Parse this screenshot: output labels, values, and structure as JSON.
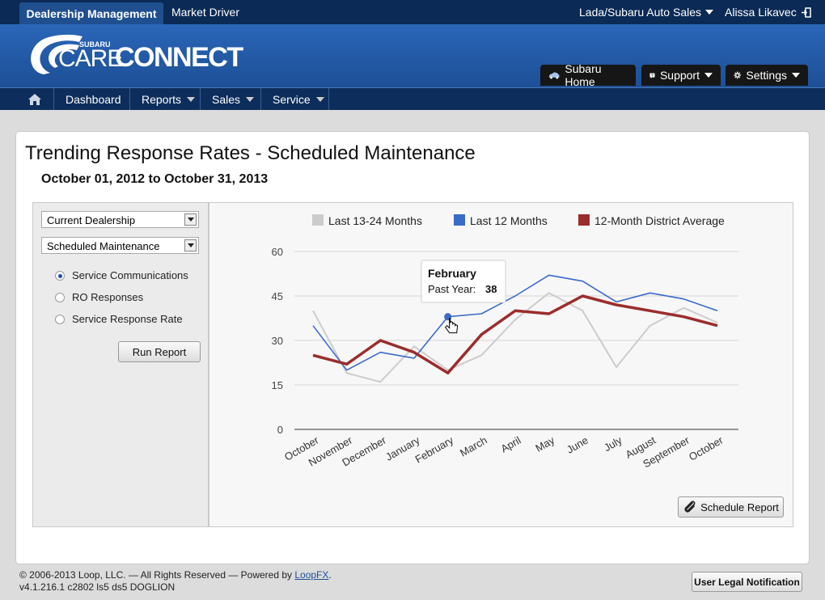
{
  "topbar": {
    "active_tab": "Dealership Management",
    "tab2": "Market Driver",
    "dealer": "Lada/Subaru Auto Sales",
    "user": "Alissa Likavec"
  },
  "header": {
    "logo_brand": "SUBARU",
    "logo_care": "CARE",
    "logo_connect": "CONNECT",
    "btn_home": "Subaru Home",
    "btn_support": "Support",
    "btn_settings": "Settings"
  },
  "nav": {
    "dashboard": "Dashboard",
    "reports": "Reports",
    "sales": "Sales",
    "service": "Service"
  },
  "report": {
    "title": "Trending Response Rates - Scheduled Maintenance",
    "date_range": "October 01, 2012 to October 31, 2013"
  },
  "filters": {
    "select1": "Current Dealership",
    "select2": "Scheduled Maintenance",
    "radio1": "Service Communications",
    "radio2": "RO Responses",
    "radio3": "Service Response Rate",
    "run_button": "Run Report"
  },
  "chart_data": {
    "type": "line",
    "categories": [
      "October",
      "November",
      "December",
      "January",
      "February",
      "March",
      "April",
      "May",
      "June",
      "July",
      "August",
      "September",
      "October"
    ],
    "ylim": [
      0,
      60
    ],
    "yticks": [
      0,
      15,
      30,
      45,
      60
    ],
    "grid": true,
    "legend_position": "top",
    "series": [
      {
        "name": "Last 13-24 Months",
        "color": "#cccccc",
        "values": [
          40,
          19,
          16,
          28,
          20,
          25,
          37,
          46,
          40,
          21,
          35,
          41,
          36
        ]
      },
      {
        "name": "Last 12 Months",
        "color": "#3a6bc8",
        "values": [
          35,
          20,
          26,
          24,
          38,
          39,
          45,
          52,
          50,
          43,
          46,
          44,
          40
        ]
      },
      {
        "name": "12-Month District Average",
        "color": "#9b2d2d",
        "values": [
          25,
          22,
          30,
          26,
          19,
          32,
          40,
          39,
          45,
          42,
          40,
          38,
          35
        ]
      }
    ],
    "tooltip": {
      "title": "February",
      "label": "Past Year:",
      "value": "38"
    }
  },
  "schedule_button": "Schedule Report",
  "footer": {
    "copyright": "© 2006-2013 Loop, LLC. — All Rights Reserved — Powered by ",
    "link": "LoopFX",
    "period": ".",
    "version": "v4.1.216.1 c2802 ls5 ds5 DOGLION",
    "legal_button": "User Legal Notification"
  }
}
